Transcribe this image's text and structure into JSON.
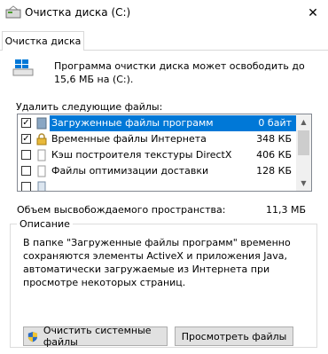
{
  "window": {
    "title": "Очистка диска  (C:)",
    "close_glyph": "✕"
  },
  "tab": {
    "label": "Очистка диска"
  },
  "intro": "Программа очистки диска может освободить до 15,6 МБ на  (C:).",
  "delete_label": "Удалить следующие файлы:",
  "files": [
    {
      "checked": true,
      "icon": "downloaded-program-files-icon",
      "name": "Загруженные файлы программ",
      "size": "0 байт",
      "selected": true
    },
    {
      "checked": true,
      "icon": "lock-icon",
      "name": "Временные файлы Интернета",
      "size": "348 КБ",
      "selected": false
    },
    {
      "checked": false,
      "icon": "blank-file-icon",
      "name": "Кэш построителя текстуры DirectX",
      "size": "406 КБ",
      "selected": false
    },
    {
      "checked": false,
      "icon": "blank-file-icon",
      "name": "Файлы оптимизации доставки",
      "size": "128 КБ",
      "selected": false
    },
    {
      "checked": false,
      "icon": "file-icon",
      "name": "",
      "size": "",
      "selected": false
    }
  ],
  "check_glyph": "✓",
  "space": {
    "label": "Объем высвобождаемого пространства:",
    "value": "11,3 МБ"
  },
  "description": {
    "title": "Описание",
    "text": "В папке \"Загруженные файлы программ\" временно сохраняются элементы ActiveX и приложения Java, автоматически загружаемые из Интернета при просмотре некоторых страниц."
  },
  "buttons": {
    "clean_system": "Очистить системные файлы",
    "view_files": "Просмотреть файлы"
  },
  "colors": {
    "selection": "#0078d7",
    "accent": "#0078d7"
  }
}
